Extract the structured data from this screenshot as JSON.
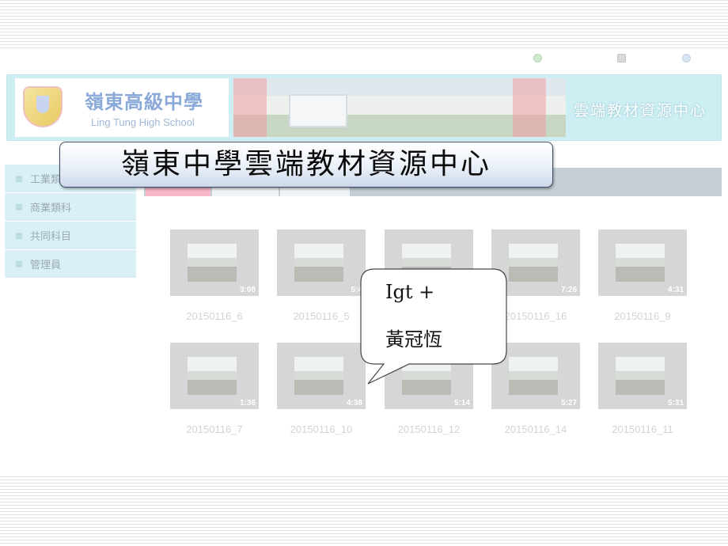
{
  "overlay": {
    "title": "嶺東中學雲端教材資源中心",
    "callout_line1": "Igt +",
    "callout_line2": "黃冠恆"
  },
  "topbar": {
    "breadcrumb": "",
    "links": [
      "",
      "",
      ""
    ]
  },
  "banner": {
    "school_name_cn": "嶺東高級中學",
    "school_name_en": "Ling Tung High School",
    "portal_title": "雲端教材資源中心"
  },
  "sidebar": {
    "items": [
      {
        "label": "工業類"
      },
      {
        "label": "商業類科"
      },
      {
        "label": "共同科目"
      },
      {
        "label": "管理員"
      }
    ],
    "note": ""
  },
  "tabs": [
    {
      "label": ""
    },
    {
      "label": ""
    },
    {
      "label": ""
    }
  ],
  "videos": [
    {
      "duration": "3:08",
      "title": "20150116_6"
    },
    {
      "duration": "5:4",
      "title": "20150116_5"
    },
    {
      "duration": "",
      "title": ""
    },
    {
      "duration": "7:26",
      "title": "20150116_16"
    },
    {
      "duration": "4:31",
      "title": "20150116_9"
    },
    {
      "duration": "1:36",
      "title": "20150116_7"
    },
    {
      "duration": "4:38",
      "title": "20150116_10"
    },
    {
      "duration": "5:14",
      "title": "20150116_12"
    },
    {
      "duration": "5:27",
      "title": "20150116_14"
    },
    {
      "duration": "5:31",
      "title": "20150116_11"
    }
  ],
  "colors": {
    "banner_bg": "#cdeff4",
    "sidebar_bg": "#d9f1f6",
    "tab_active": "#f7b8c8",
    "title_border": "#3b4a66"
  }
}
